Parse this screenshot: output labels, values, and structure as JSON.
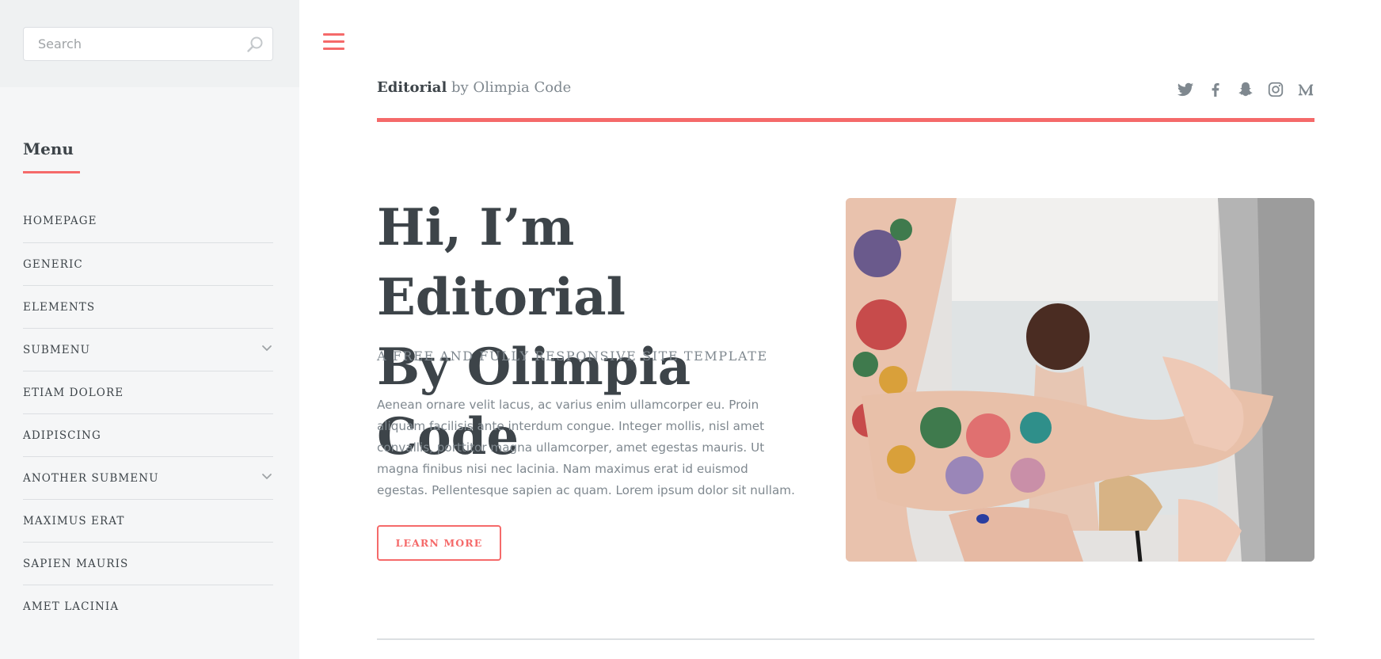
{
  "search": {
    "placeholder": "Search",
    "icon": "search-icon"
  },
  "sidebar": {
    "menu_title": "Menu",
    "items": [
      {
        "label": "HOMEPAGE",
        "has_submenu": false
      },
      {
        "label": "GENERIC",
        "has_submenu": false
      },
      {
        "label": "ELEMENTS",
        "has_submenu": false
      },
      {
        "label": "SUBMENU",
        "has_submenu": true
      },
      {
        "label": "ETIAM DOLORE",
        "has_submenu": false
      },
      {
        "label": "ADIPISCING",
        "has_submenu": false
      },
      {
        "label": "ANOTHER SUBMENU",
        "has_submenu": true
      },
      {
        "label": "MAXIMUS ERAT",
        "has_submenu": false
      },
      {
        "label": "SAPIEN MAURIS",
        "has_submenu": false
      },
      {
        "label": "AMET LACINIA",
        "has_submenu": false
      }
    ]
  },
  "header": {
    "brand_strong": "Editorial",
    "brand_rest": " by Olimpia Code",
    "social": [
      "twitter-icon",
      "facebook-icon",
      "snapchat-icon",
      "instagram-icon",
      "medium-icon"
    ]
  },
  "hero": {
    "title_line1": "Hi, I’m Editorial",
    "title_line2": "By Olimpia Code",
    "subtitle": "A FREE AND FULLY RESPONSIVE SITE TEMPLATE",
    "body": "Aenean ornare velit lacus, ac varius enim ullamcorper eu. Proin aliquam facilisis ante interdum congue. Integer mollis, nisl amet convallis, porttitor magna ullamcorper, amet egestas mauris. Ut magna finibus nisi nec lacinia. Nam maximus erat id euismod egestas. Pellentesque sapien ac quam. Lorem ipsum dolor sit nullam.",
    "button_label": "LEARN MORE"
  },
  "colors": {
    "accent": "#f56a6a",
    "text_dark": "#3d4449",
    "text_muted": "#7f888f",
    "sidebar_bg": "#f5f6f7"
  }
}
